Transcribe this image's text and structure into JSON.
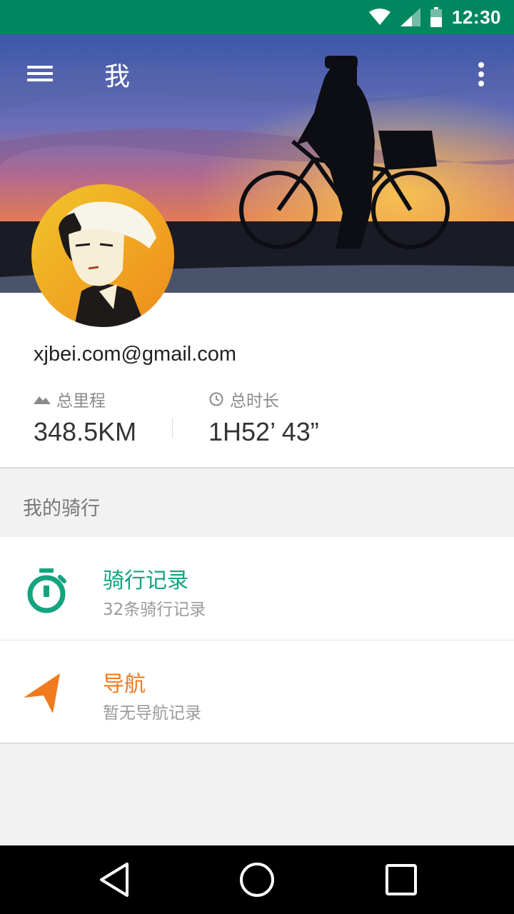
{
  "status_bar": {
    "time": "12:30",
    "icons": [
      "wifi-icon",
      "cell-signal-icon",
      "battery-icon"
    ]
  },
  "header": {
    "title": "我",
    "menu_icon": "hamburger-menu-icon",
    "overflow_icon": "more-vert-icon"
  },
  "profile": {
    "email": "xjbei.com@gmail.com",
    "stats": [
      {
        "icon": "terrain-icon",
        "label": "总里程",
        "value": "348.5KM"
      },
      {
        "icon": "clock-icon",
        "label": "总时长",
        "value": "1H52’ 43”"
      }
    ]
  },
  "section": {
    "title": "我的骑行"
  },
  "list": [
    {
      "icon": "stopwatch-icon",
      "title": "骑行记录",
      "subtitle": "32条骑行记录",
      "color": "#14a37f"
    },
    {
      "icon": "navigation-arrow-icon",
      "title": "导航",
      "subtitle": "暂无导航记录",
      "color": "#f07a1e"
    }
  ],
  "nav_bar": {
    "icons": [
      "back-icon",
      "home-icon",
      "recents-icon"
    ]
  },
  "colors": {
    "status_bar": "#00875f",
    "accent_green": "#14a37f",
    "accent_orange": "#f07a1e"
  }
}
